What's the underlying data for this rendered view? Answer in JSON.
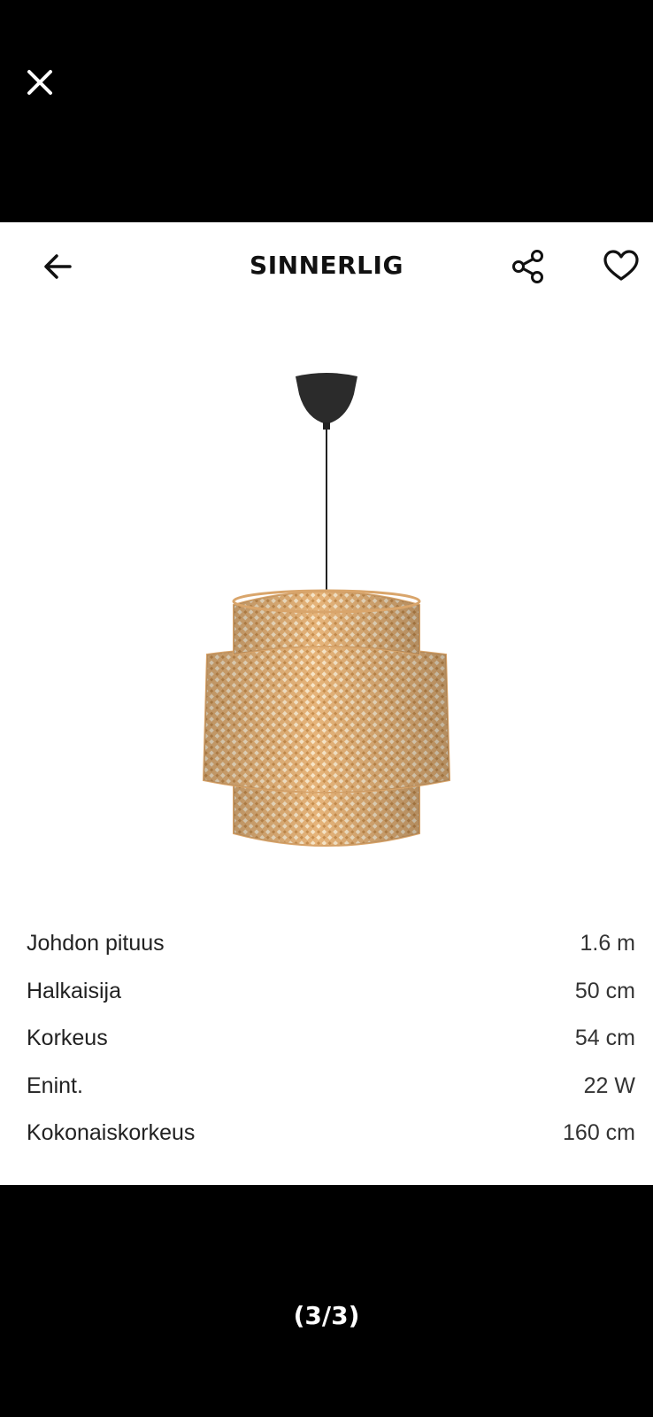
{
  "header": {
    "title": "SINNERLIG"
  },
  "icons": {
    "close": "close-icon",
    "back": "arrow-left-icon",
    "share": "share-icon",
    "favorite": "heart-icon"
  },
  "specs": [
    {
      "label": "Johdon pituus",
      "value": "1.6 m"
    },
    {
      "label": "Halkaisija",
      "value": "50 cm"
    },
    {
      "label": "Korkeus",
      "value": "54 cm"
    },
    {
      "label": "Enint.",
      "value": "22 W"
    },
    {
      "label": "Kokonaiskorkeus",
      "value": "160 cm"
    }
  ],
  "pager": {
    "counter": "(3/3)"
  },
  "colors": {
    "background": "#000000",
    "card": "#ffffff",
    "shade": "#e2b27c"
  }
}
